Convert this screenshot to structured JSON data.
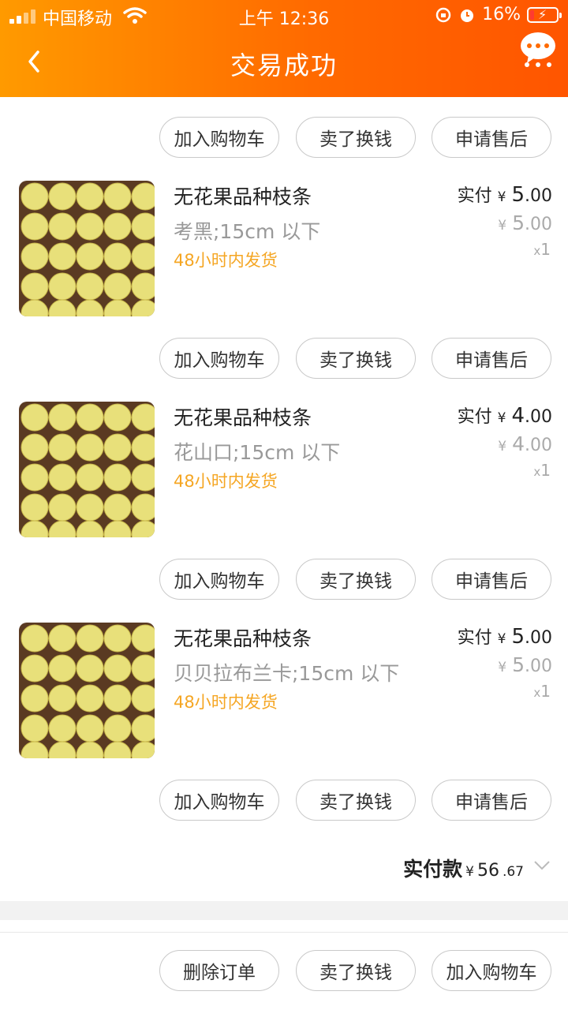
{
  "status": {
    "carrier": "中国移动",
    "time": "上午 12:36",
    "battery": "16%"
  },
  "header": {
    "title": "交易成功"
  },
  "buttons": {
    "add_cart": "加入购物车",
    "sell": "卖了换钱",
    "after_sale": "申请售后",
    "delete": "删除订单"
  },
  "items": [
    {
      "name": "无花果品种枝条",
      "sku": "考黑;15cm 以下",
      "ship": "48小时内发货",
      "paid_label": "实付",
      "paid_int": "5",
      "paid_dec": ".00",
      "orig_int": "5",
      "orig_dec": ".00",
      "qty": "1"
    },
    {
      "name": "无花果品种枝条",
      "sku": "花山口;15cm 以下",
      "ship": "48小时内发货",
      "paid_label": "实付",
      "paid_int": "4",
      "paid_dec": ".00",
      "orig_int": "4",
      "orig_dec": ".00",
      "qty": "1"
    },
    {
      "name": "无花果品种枝条",
      "sku": "贝贝拉布兰卡;15cm 以下",
      "ship": "48小时内发货",
      "paid_label": "实付",
      "paid_int": "5",
      "paid_dec": ".00",
      "orig_int": "5",
      "orig_dec": ".00",
      "qty": "1"
    }
  ],
  "currency": "¥",
  "qty_prefix": "x",
  "total": {
    "label": "实付款",
    "int": "56",
    "dec": ".67"
  },
  "colors": {
    "header_start": "#ff9a00",
    "header_end": "#ff5500",
    "ship": "#f5a623"
  }
}
